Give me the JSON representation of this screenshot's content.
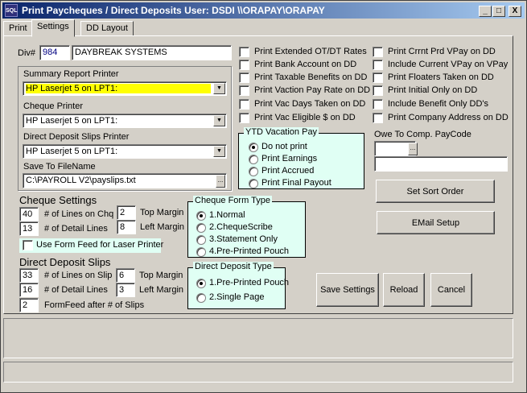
{
  "window": {
    "title": "Print Paycheques / Direct Deposits  User: DSDI  \\\\ORAPAY\\ORAPAY",
    "icon_text": "SQL",
    "min_symbol": "_",
    "max_symbol": "□",
    "close_symbol": "X"
  },
  "tabs": [
    "Print",
    "Settings",
    "DD Layout"
  ],
  "div": {
    "label": "Div#",
    "code": "984",
    "name": "DAYBREAK SYSTEMS"
  },
  "printers": {
    "summary_label": "Summary Report Printer",
    "summary_value": "HP Laserjet 5 on LPT1:",
    "cheque_label": "Cheque Printer",
    "cheque_value": "HP Laserjet 5 on LPT1:",
    "dd_label": "Direct Deposit Slips Printer",
    "dd_value": "HP Laserjet 5 on LPT1:",
    "save_label": "Save To FileName",
    "save_value": "C:\\PAYROLL V2\\payslips.txt",
    "browse": "..."
  },
  "options_left": [
    "Print Extended OT/DT Rates",
    "Print Bank Account on DD",
    "Print Taxable Benefits on DD",
    "Print Vaction Pay Rate on DD",
    "Print Vac Days Taken on DD",
    "Print Vac Eligible $ on DD"
  ],
  "options_right": [
    "Print Crrnt Prd VPay on DD",
    "Include Current VPay on VPay",
    "Print Floaters Taken on DD",
    "Print Initial Only on DD",
    "Include Benefit Only DD's",
    "Print Company Address on DD"
  ],
  "ytd": {
    "title": "YTD Vacation Pay",
    "options": [
      "Do not print",
      "Print Earnings",
      "Print Accrued",
      "Print Final Payout"
    ],
    "selected": "Do not print"
  },
  "owe": {
    "label": "Owe To Comp. PayCode",
    "browse": "..."
  },
  "buttons": {
    "sort": "Set Sort Order",
    "email": "EMail Setup",
    "save": "Save Settings",
    "reload": "Reload",
    "cancel": "Cancel"
  },
  "cheque_settings": {
    "title": "Cheque Settings",
    "lines_on_chq": "40",
    "lines_on_chq_label": "# of Lines on Chq",
    "detail_lines": "13",
    "detail_lines_label": "# of Detail Lines",
    "top_margin": "2",
    "top_margin_label": "Top Margin",
    "left_margin": "8",
    "left_margin_label": "Left Margin",
    "form_feed_label": "Use Form Feed  for Laser Printer"
  },
  "cheque_form": {
    "title": "Cheque Form Type",
    "options": [
      "1.Normal",
      "2.ChequeScribe",
      "3.Statement Only",
      "4.Pre-Printed Pouch"
    ],
    "selected": "1.Normal"
  },
  "dd_slips": {
    "title": "Direct Deposit Slips",
    "lines_on_slip": "33",
    "lines_on_slip_label": "# of Lines on Slip",
    "detail_lines": "16",
    "detail_lines_label": "# of Detail Lines",
    "top_margin": "6",
    "top_margin_label": "Top Margin",
    "left_margin": "3",
    "left_margin_label": "Left Margin",
    "formfeed": "2",
    "formfeed_label": "FormFeed after # of Slips"
  },
  "dd_type": {
    "title": "Direct Deposit Type",
    "options": [
      "1.Pre-Printed Pouch",
      "2.Single Page"
    ],
    "selected": "1.Pre-Printed Pouch"
  },
  "colors": {
    "highlight": "#ffff00",
    "group_bg": "#e0fff4",
    "div_code": "#000080",
    "title_start": "#0a246a"
  }
}
